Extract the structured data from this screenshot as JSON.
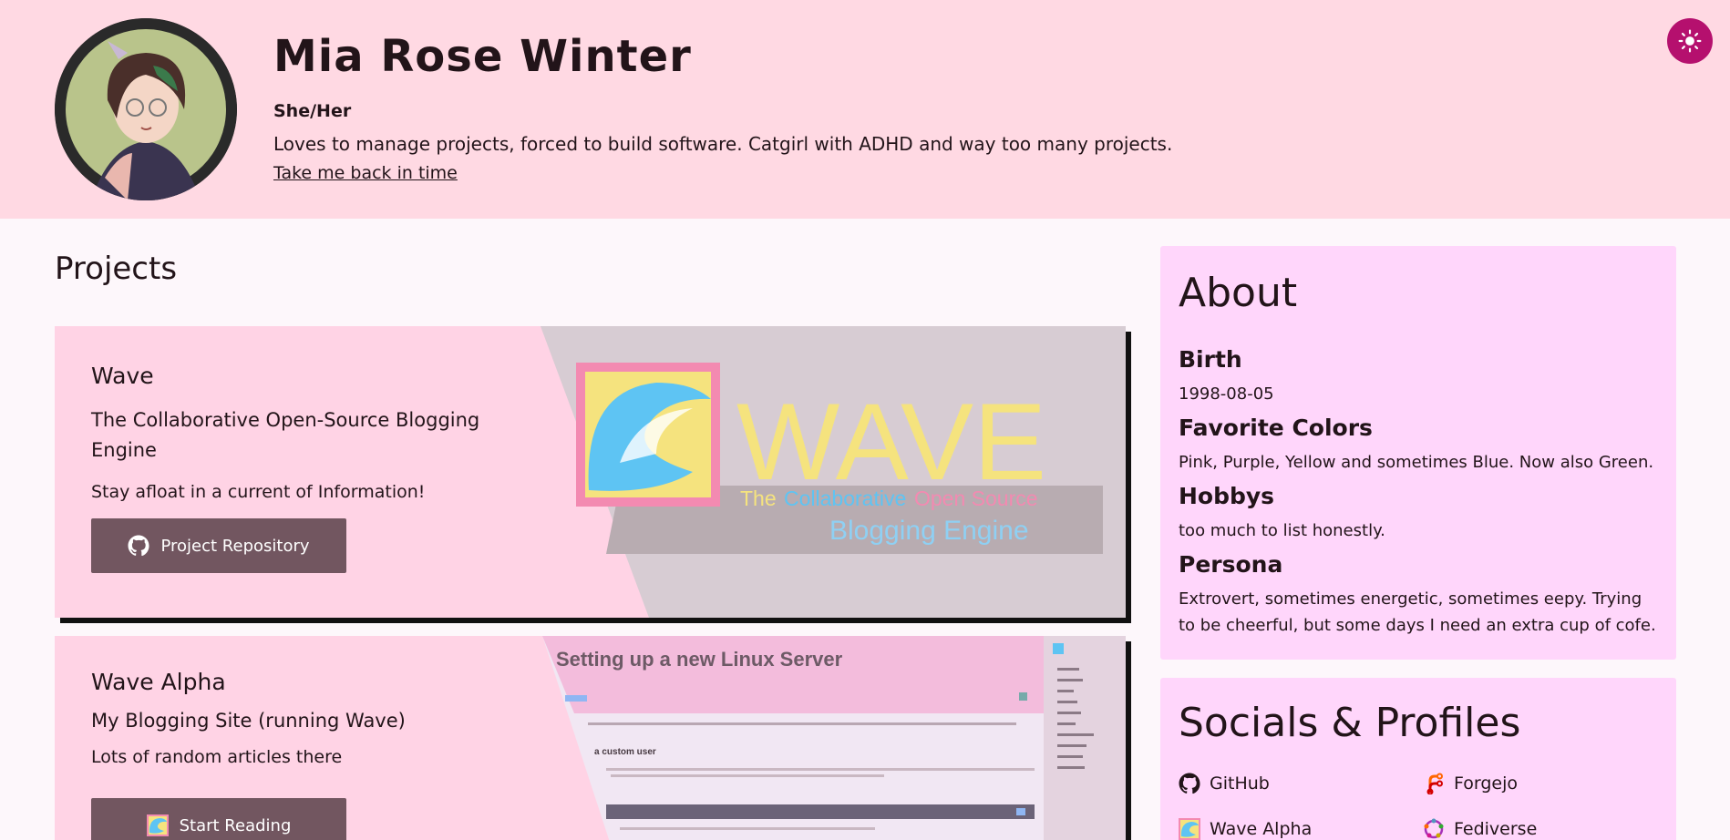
{
  "header": {
    "name": "Mia Rose Winter",
    "pronouns": "She/Her",
    "bio": "Loves to manage projects, forced to build software. Catgirl with ADHD and way too many projects.",
    "back_link": "Take me back in time",
    "theme_icon": "sun-icon"
  },
  "projects": {
    "title": "Projects",
    "items": [
      {
        "title": "Wave",
        "subtitle": "The Collaborative Open-Source Blogging Engine",
        "description": "Stay afloat in a current of Information!",
        "button_label": "Project Repository",
        "button_icon": "github-icon",
        "image": {
          "wordmark": "WAVE",
          "tagline_1": "The",
          "tagline_2": "Collaborative",
          "tagline_3": "Open Source",
          "tagline_4": "Blogging Engine"
        }
      },
      {
        "title": "Wave Alpha",
        "subtitle": "My Blogging Site (running Wave)",
        "description": "Lots of random articles there",
        "button_label": "Start Reading",
        "button_icon": "wave-logo-icon",
        "image": {
          "article_title": "Setting up a new Linux Server",
          "section": "a custom user",
          "sidebar_items": [
            "Startpage",
            "New Article",
            "Drafts",
            "In Review",
            "Publishing",
            "Deleted",
            "Manage Categories",
            "Manage Users",
            "Manage API",
            "Newsletter"
          ]
        }
      }
    ]
  },
  "about": {
    "title": "About",
    "entries": [
      {
        "label": "Birth",
        "value": "1998-08-05"
      },
      {
        "label": "Favorite Colors",
        "value": "Pink, Purple, Yellow and sometimes Blue. Now also Green."
      },
      {
        "label": "Hobbys",
        "value": "too much to list honestly."
      },
      {
        "label": "Persona",
        "value": "Extrovert, sometimes energetic, sometimes eepy. Trying to be cheerful, but some days I need an extra cup of cofe."
      }
    ]
  },
  "socials": {
    "title": "Socials & Profiles",
    "items": [
      {
        "label": "GitHub",
        "icon": "github-icon"
      },
      {
        "label": "Forgejo",
        "icon": "forgejo-icon"
      },
      {
        "label": "Wave Alpha",
        "icon": "wave-logo-icon"
      },
      {
        "label": "Fediverse",
        "icon": "fediverse-icon"
      }
    ]
  },
  "colors": {
    "header_bg": "#ffd9e3",
    "accent": "#b5106e",
    "card_bg": "#ffd3e5",
    "button_bg": "#725660",
    "panel_bg": "#ffd6fb"
  }
}
